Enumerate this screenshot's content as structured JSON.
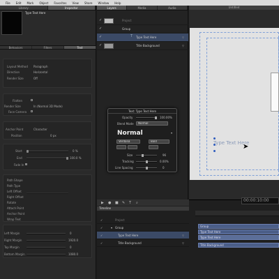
{
  "menubar": {
    "apple": "",
    "items": [
      "File",
      "Edit",
      "Mark",
      "Object",
      "Favorites",
      "View",
      "Share",
      "Window",
      "Help"
    ]
  },
  "inspector": {
    "tabs": [
      "Library",
      "Inspector"
    ],
    "active_tab": "Inspector",
    "selection_title": "Type Text Here",
    "subtabs": [
      "Behaviors",
      "Filters",
      "Text"
    ],
    "layout_rows": [
      {
        "label": "Layout Method",
        "value": "Paragraph"
      },
      {
        "label": "Direction",
        "value": "Horizontal"
      },
      {
        "label": "Render Size",
        "value": "Off"
      }
    ],
    "flatten_rows": [
      {
        "label": "Flatten",
        "value": ""
      },
      {
        "label": "Render Size",
        "value": "In (Normal 3D Mode)"
      },
      {
        "label": "Face Camera",
        "value": ""
      }
    ],
    "sequence_rows": [
      {
        "label": "Anchor Point",
        "value": "Character"
      },
      {
        "label": "Position",
        "value": "0 px"
      }
    ],
    "mid_rows": [
      {
        "label": "Start",
        "value": "0 %"
      },
      {
        "label": "End",
        "value": "100.0 %"
      },
      {
        "label": "Fade In",
        "value": ""
      }
    ],
    "disabled_rows": [
      "Path Shape",
      "Path Type",
      "Left Offset",
      "Right Offset",
      "Rotate",
      "Attach Point",
      "Anchor Point",
      "Wrap Text"
    ],
    "margin_rows": [
      {
        "label": "Left Margin",
        "value": "0"
      },
      {
        "label": "Right Margin",
        "value": "1920.0"
      },
      {
        "label": "Top Margin",
        "value": "0"
      },
      {
        "label": "Bottom Margin",
        "value": "1080.0"
      }
    ]
  },
  "layers_panel": {
    "tabs": [
      "Layers",
      "Media",
      "Audio"
    ],
    "active_tab": "Layers",
    "rows": [
      {
        "name": "Project",
        "selected": false
      },
      {
        "name": "Group",
        "selected": false
      },
      {
        "name": "Type Text Here",
        "selected": true
      },
      {
        "name": "Title Background",
        "selected": false
      }
    ]
  },
  "hud": {
    "title": "Text: Type Text Here",
    "opacity_label": "Opacity",
    "opacity_value": "100.00%",
    "blend_label": "Blend Mode",
    "blend_value": "Normal",
    "style_value": "Normal",
    "font_family": "Verdana",
    "font_style": "Bold",
    "size_label": "Size",
    "size_value": "96",
    "tracking_label": "Tracking",
    "tracking_value": "0.00%",
    "line_spacing_label": "Line Spacing",
    "line_spacing_value": "0"
  },
  "canvas": {
    "title": "Untitled",
    "text": "Type Text Here"
  },
  "timeline": {
    "tab": "Timeline",
    "timecode": "00:00:10:00",
    "rows": [
      {
        "name": "Project",
        "selected": false
      },
      {
        "name": "Group",
        "selected": false
      },
      {
        "name": "Type Text Here",
        "selected": true
      },
      {
        "name": "Title Background",
        "selected": false
      }
    ],
    "bars": [
      "Group",
      "Type Text Here",
      "Type Text Here",
      "Title Background"
    ]
  },
  "colors": {
    "selection": "#3b4a66",
    "timeline_bar": "#4b5e88",
    "handle": "#2d5bbd"
  }
}
